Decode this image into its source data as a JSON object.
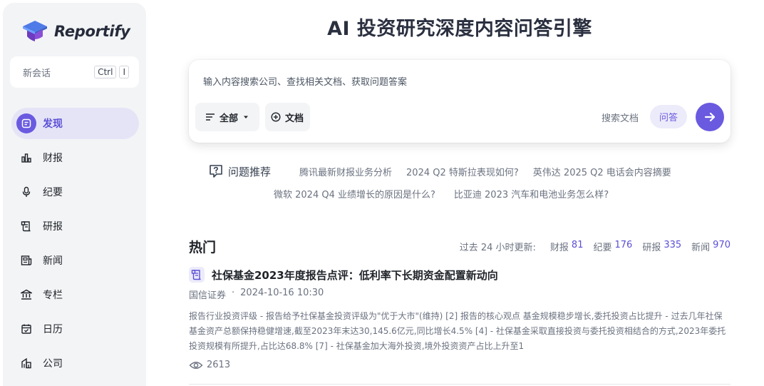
{
  "app": {
    "brand": "Reportify"
  },
  "sidebar": {
    "new_chat": {
      "label": "新会话",
      "keys": [
        "Ctrl",
        "I"
      ]
    },
    "items": [
      {
        "label": "发现",
        "icon": "discover-icon",
        "active": true
      },
      {
        "label": "财报",
        "icon": "bar-chart-icon",
        "active": false
      },
      {
        "label": "纪要",
        "icon": "microphone-icon",
        "active": false
      },
      {
        "label": "研报",
        "icon": "scroll-icon",
        "active": false
      },
      {
        "label": "新闻",
        "icon": "newspaper-icon",
        "active": false
      },
      {
        "label": "专栏",
        "icon": "bank-icon",
        "active": false
      },
      {
        "label": "日历",
        "icon": "calendar-icon",
        "active": false
      },
      {
        "label": "公司",
        "icon": "building-icon",
        "active": false
      }
    ]
  },
  "main": {
    "title": "AI 投资研究深度内容问答引擎",
    "search": {
      "placeholder": "输入内容搜索公司、查找相关文档、获取问题答案",
      "scope_label": "全部",
      "doc_label": "文档",
      "search_doc_label": "搜索文档",
      "qa_label": "问答"
    },
    "suggestions": {
      "header": "问题推荐",
      "items": [
        "腾讯最新财报业务分析",
        "2024 Q2 特斯拉表现如何?",
        "英伟达 2025 Q2 电话会内容摘要",
        "微软 2024 Q4 业绩增长的原因是什么?",
        "比亚迪 2023 汽车和电池业务怎么样?"
      ]
    },
    "hot": {
      "title": "热门",
      "stats_lead": "过去 24 小时更新:",
      "stats": [
        {
          "label": "财报",
          "value": "81"
        },
        {
          "label": "纪要",
          "value": "176"
        },
        {
          "label": "研报",
          "value": "335"
        },
        {
          "label": "新闻",
          "value": "970"
        }
      ],
      "articles": [
        {
          "title": "社保基金2023年度报告点评：低利率下长期资金配置新动向",
          "source": "国信证券",
          "separator": "·",
          "datetime": "2024-10-16 10:30",
          "summary": "报告行业投资评级 - 报告给予社保基金投资评级为\"优于大市\"(维持) [2] 报告的核心观点 基金规模稳步增长,委托投资占比提升 - 过去几年社保基金资产总额保持稳健增速,截至2023年末达30,145.6亿元,同比增长4.5% [4] - 社保基金采取直接投资与委托投资相结合的方式,2023年委托投资规模有所提升,占比达68.8% [7] - 社保基金加大海外投资,境外投资资产占比上升至1",
          "views": "2613"
        }
      ]
    }
  },
  "colors": {
    "accent": "#6a5ae0",
    "accent_soft": "#ecebfa",
    "sidebar_bg": "#f3f4f6"
  }
}
